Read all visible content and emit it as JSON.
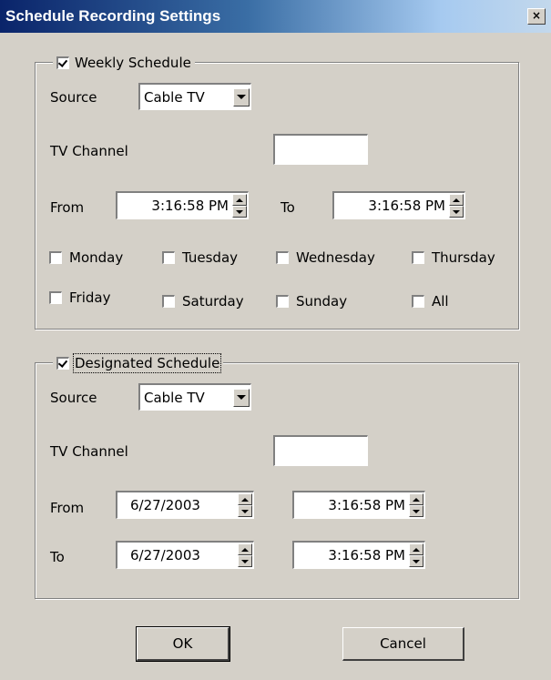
{
  "window": {
    "title": "Schedule Recording Settings",
    "close_glyph": "×"
  },
  "weekly": {
    "enabled": true,
    "label": "Weekly Schedule",
    "source_label": "Source",
    "source_value": "Cable TV",
    "channel_label": "TV Channel",
    "channel_value": "",
    "from_label": "From",
    "from_time": "3:16:58 PM",
    "to_label": "To",
    "to_time": "3:16:58 PM",
    "days": [
      {
        "label": "Monday",
        "checked": false
      },
      {
        "label": "Tuesday",
        "checked": false
      },
      {
        "label": "Wednesday",
        "checked": false
      },
      {
        "label": "Thursday",
        "checked": false
      },
      {
        "label": "Friday",
        "checked": false
      },
      {
        "label": "Saturday",
        "checked": false
      },
      {
        "label": "Sunday",
        "checked": false
      },
      {
        "label": "All",
        "checked": false
      }
    ]
  },
  "designated": {
    "enabled": true,
    "label": "Designated Schedule",
    "source_label": "Source",
    "source_value": "Cable TV",
    "channel_label": "TV Channel",
    "channel_value": "",
    "from_label": "From",
    "from_date": "6/27/2003",
    "from_time": "3:16:58 PM",
    "to_label": "To",
    "to_date": "6/27/2003",
    "to_time": "3:16:58 PM"
  },
  "buttons": {
    "ok": "OK",
    "cancel": "Cancel"
  },
  "icons": {
    "close": "close-icon",
    "dropdown": "chevron-down-icon",
    "spin_up": "spin-up-icon",
    "spin_down": "spin-down-icon"
  }
}
